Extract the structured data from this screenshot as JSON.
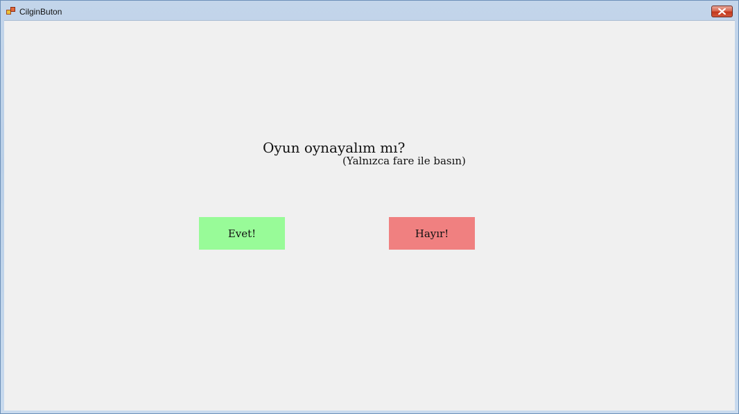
{
  "window": {
    "title": "CilginButon",
    "close_icon": "close-icon"
  },
  "main": {
    "question": "Oyun oynayalım mı?",
    "hint": "(Yalnızca fare ile basın)",
    "yes_button": {
      "label": "Evet!",
      "color": "#98fb98"
    },
    "no_button": {
      "label": "Hayır!",
      "color": "#f08080"
    }
  }
}
